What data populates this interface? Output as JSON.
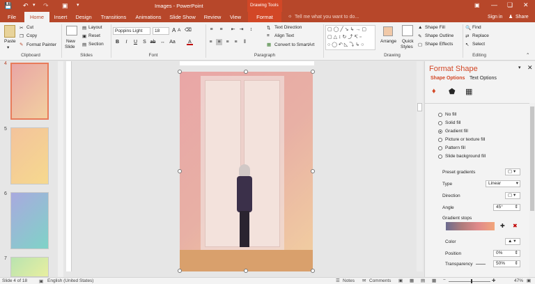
{
  "window": {
    "title": "Images - PowerPoint",
    "context_label": "Drawing Tools",
    "sign_in": "Sign in",
    "share": "Share"
  },
  "tabs": [
    "File",
    "Home",
    "Insert",
    "Design",
    "Transitions",
    "Animations",
    "Slide Show",
    "Review",
    "View",
    "Format"
  ],
  "tell_me": "Tell me what you want to do...",
  "ribbon": {
    "clipboard": {
      "label": "Clipboard",
      "paste": "Paste",
      "cut": "Cut",
      "copy": "Copy",
      "format_painter": "Format Painter"
    },
    "slides": {
      "label": "Slides",
      "new_slide": "New",
      "new_slide2": "Slide",
      "layout": "Layout",
      "reset": "Reset",
      "section": "Section"
    },
    "font": {
      "label": "Font",
      "font_name": "Poppins Light",
      "font_size": "18"
    },
    "paragraph": {
      "label": "Paragraph",
      "text_direction": "Text Direction",
      "align_text": "Align Text",
      "convert": "Convert to SmartArt"
    },
    "drawing": {
      "label": "Drawing",
      "arrange": "Arrange",
      "quick_styles": "Quick",
      "quick_styles2": "Styles",
      "shape_fill": "Shape Fill",
      "shape_outline": "Shape Outline",
      "shape_effects": "Shape Effects"
    },
    "editing": {
      "label": "Editing",
      "find": "Find",
      "replace": "Replace",
      "select": "Select"
    }
  },
  "thumbnails": [
    {
      "num": "4"
    },
    {
      "num": "5"
    },
    {
      "num": "6"
    },
    {
      "num": "7"
    }
  ],
  "pane": {
    "title": "Format Shape",
    "tab_shape": "Shape Options",
    "tab_text": "Text Options",
    "fill_options": [
      "No fill",
      "Solid fill",
      "Gradient fill",
      "Picture or texture fill",
      "Pattern fill",
      "Slide background fill"
    ],
    "preset_gradients": "Preset gradients",
    "type_label": "Type",
    "type_value": "Linear",
    "direction_label": "Direction",
    "angle_label": "Angle",
    "angle_value": "45°",
    "gradient_stops": "Gradient stops",
    "color_label": "Color",
    "position_label": "Position",
    "position_value": "0%",
    "transparency_label": "Transparency",
    "transparency_value": "50%"
  },
  "status": {
    "slide": "Slide 4 of 18",
    "language": "English (United States)",
    "notes": "Notes",
    "comments": "Comments",
    "zoom": "47%"
  }
}
